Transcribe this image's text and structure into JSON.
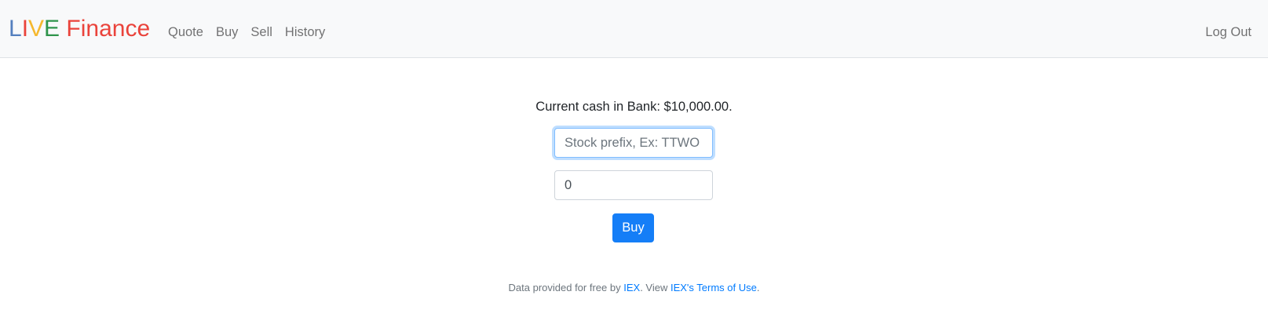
{
  "brand": {
    "letters": [
      {
        "char": "L",
        "color": "#537fbe"
      },
      {
        "char": "I",
        "color": "#ea433b"
      },
      {
        "char": "V",
        "color": "#f5b82e"
      },
      {
        "char": "E",
        "color": "#2e944b"
      },
      {
        "char": " Finance",
        "color": "#ea433b"
      }
    ]
  },
  "nav": {
    "items": [
      {
        "label": "Quote"
      },
      {
        "label": "Buy"
      },
      {
        "label": "Sell"
      },
      {
        "label": "History"
      }
    ],
    "logout_label": "Log Out"
  },
  "main": {
    "cash_text": "Current cash in Bank: $10,000.00.",
    "symbol_input": {
      "placeholder": "Stock prefix, Ex: TTWO",
      "value": ""
    },
    "shares_input": {
      "placeholder": "",
      "value": "0"
    },
    "buy_button_label": "Buy"
  },
  "footer": {
    "prefix": "Data provided for free by ",
    "iex_link": "IEX",
    "middle": ". View ",
    "terms_link": "IEX's Terms of Use",
    "suffix": "."
  }
}
